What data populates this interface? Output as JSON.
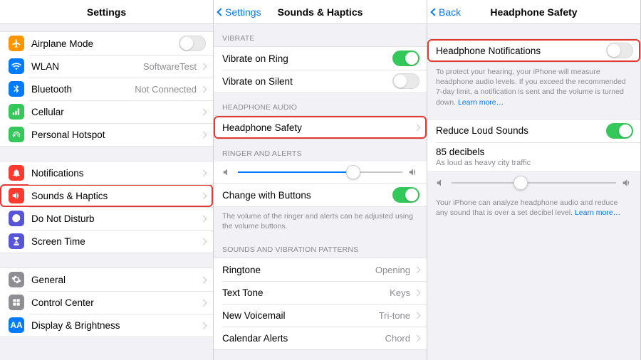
{
  "pane1": {
    "title": "Settings",
    "groups": [
      {
        "rows": [
          {
            "label": "Airplane Mode",
            "type": "toggle",
            "on": false,
            "iconColor": "#ff9500",
            "iconName": "airplane-icon"
          },
          {
            "label": "WLAN",
            "value": "SoftwareTest",
            "iconColor": "#007aff",
            "iconName": "wifi-icon"
          },
          {
            "label": "Bluetooth",
            "value": "Not Connected",
            "iconColor": "#007aff",
            "iconName": "bluetooth-icon"
          },
          {
            "label": "Cellular",
            "iconColor": "#34c759",
            "iconName": "cellular-icon"
          },
          {
            "label": "Personal Hotspot",
            "iconColor": "#34c759",
            "iconName": "hotspot-icon"
          }
        ]
      },
      {
        "rows": [
          {
            "label": "Notifications",
            "iconColor": "#ff3b30",
            "iconName": "notifications-icon"
          },
          {
            "label": "Sounds & Haptics",
            "iconColor": "#ff3b30",
            "highlight": true,
            "iconName": "sounds-icon"
          },
          {
            "label": "Do Not Disturb",
            "iconColor": "#5856d6",
            "iconName": "dnd-icon"
          },
          {
            "label": "Screen Time",
            "iconColor": "#5856d6",
            "iconName": "screentime-icon"
          }
        ]
      },
      {
        "rows": [
          {
            "label": "General",
            "iconColor": "#8e8e93",
            "iconName": "general-icon"
          },
          {
            "label": "Control Center",
            "iconColor": "#8e8e93",
            "iconName": "control-center-icon"
          },
          {
            "label": "Display & Brightness",
            "iconColor": "#007aff",
            "iconGlyph": "AA",
            "iconName": "display-icon"
          }
        ]
      }
    ]
  },
  "pane2": {
    "back": "Settings",
    "title": "Sounds & Haptics",
    "sections": [
      {
        "header": "VIBRATE",
        "rows": [
          {
            "label": "Vibrate on Ring",
            "type": "toggle",
            "on": true
          },
          {
            "label": "Vibrate on Silent",
            "type": "toggle",
            "on": false
          }
        ]
      },
      {
        "header": "HEADPHONE AUDIO",
        "rows": [
          {
            "label": "Headphone Safety",
            "type": "disclosure",
            "highlight": true
          }
        ]
      },
      {
        "header": "RINGER AND ALERTS",
        "slider": {
          "percent": 70
        },
        "rows": [
          {
            "label": "Change with Buttons",
            "type": "toggle",
            "on": true
          }
        ],
        "footer": "The volume of the ringer and alerts can be adjusted using the volume buttons."
      },
      {
        "header": "SOUNDS AND VIBRATION PATTERNS",
        "rows": [
          {
            "label": "Ringtone",
            "value": "Opening",
            "type": "disclosure"
          },
          {
            "label": "Text Tone",
            "value": "Keys",
            "type": "disclosure"
          },
          {
            "label": "New Voicemail",
            "value": "Tri-tone",
            "type": "disclosure"
          },
          {
            "label": "Calendar Alerts",
            "value": "Chord",
            "type": "disclosure"
          }
        ]
      }
    ]
  },
  "pane3": {
    "back": "Back",
    "title": "Headphone Safety",
    "rows1": [
      {
        "label": "Headphone Notifications",
        "type": "toggle",
        "on": false,
        "highlight": true
      }
    ],
    "footer1_a": "To protect your hearing, your iPhone will measure headphone audio levels. If you exceed the recommended 7-day limit, a notification is sent and the volume is turned down. ",
    "footer1_link": "Learn more…",
    "rows2": [
      {
        "label": "Reduce Loud Sounds",
        "type": "toggle",
        "on": true
      }
    ],
    "decibel": "85 decibels",
    "decibel_sub": "As loud as heavy city traffic",
    "slider2": {
      "percent": 42
    },
    "footer2_a": "Your iPhone can analyze headphone audio and reduce any sound that is over a set decibel level. ",
    "footer2_link": "Learn more…"
  }
}
